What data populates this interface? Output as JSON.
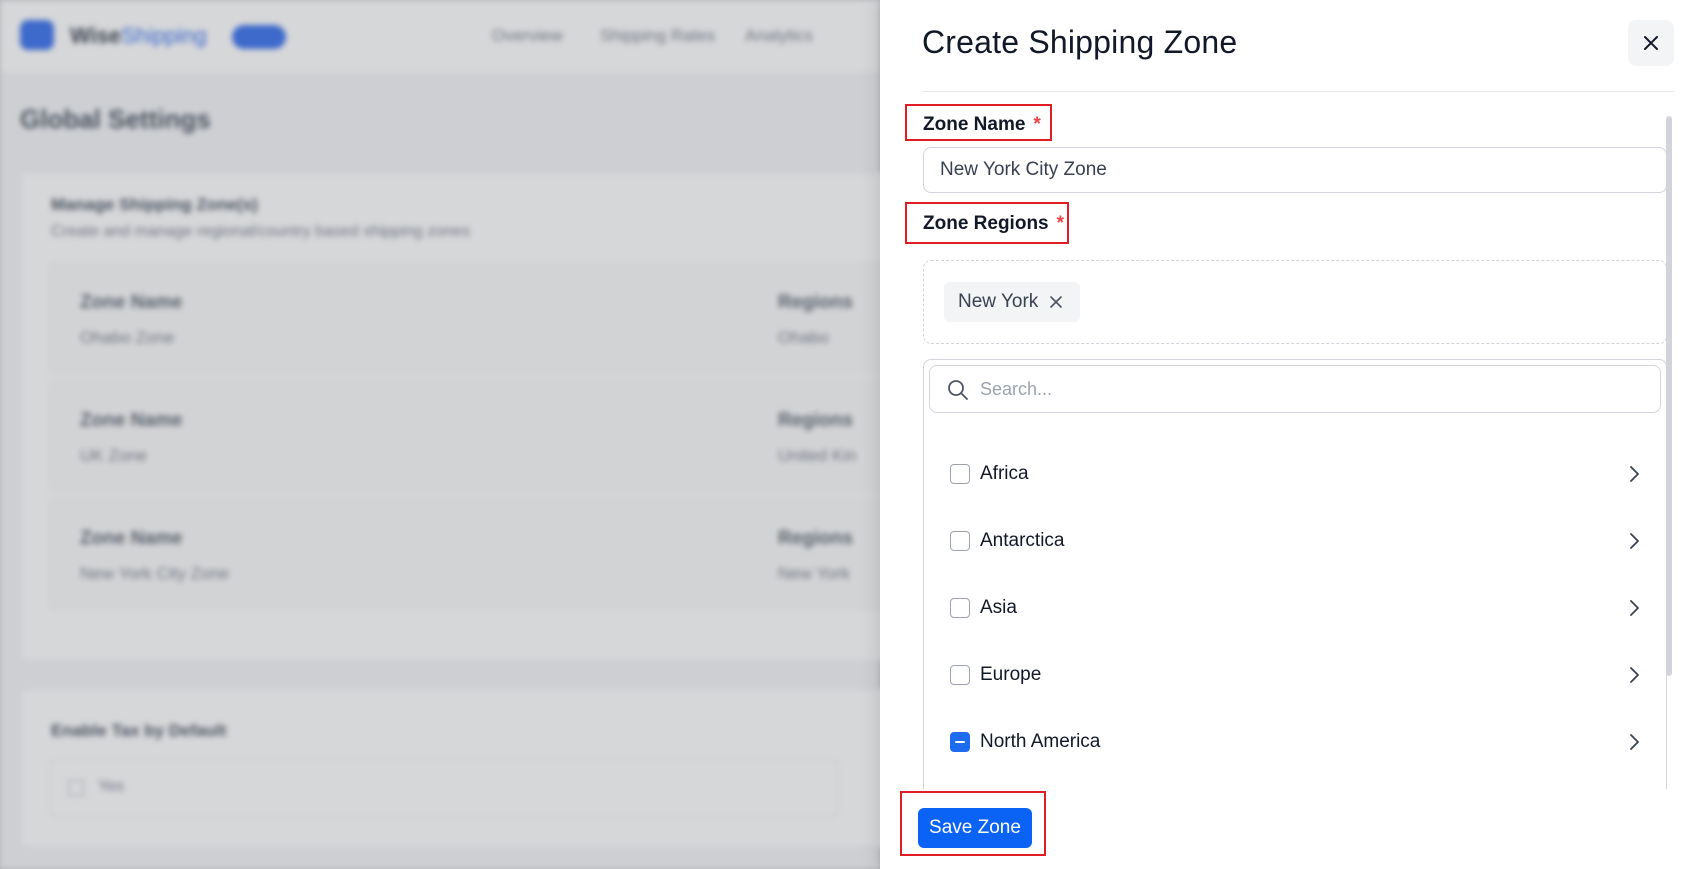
{
  "background": {
    "logo_text_dark": "Wise",
    "logo_text_accent": "Shipping",
    "nav": [
      "Overview",
      "Shipping Rates",
      "Analytics"
    ],
    "page_title": "Global Settings",
    "card_title": "Manage Shipping Zone(s)",
    "card_subtitle": "Create and manage regional/country based shipping zones",
    "zones": [
      {
        "label": "Zone Name",
        "value": "Ohabo Zone",
        "regions_label": "Regions",
        "regions_value": "Ohabo"
      },
      {
        "label": "Zone Name",
        "value": "UK Zone",
        "regions_label": "Regions",
        "regions_value": "United Kin"
      },
      {
        "label": "Zone Name",
        "value": "New York City Zone",
        "regions_label": "Regions",
        "regions_value": "New York"
      }
    ],
    "card2_title": "Enable Tax by Default",
    "card2_option": "Yes"
  },
  "drawer": {
    "title": "Create Shipping Zone",
    "zone_name": {
      "label": "Zone Name",
      "required_mark": "*",
      "value": "New York City Zone"
    },
    "zone_regions": {
      "label": "Zone Regions",
      "required_mark": "*",
      "selected": [
        {
          "label": "New York"
        }
      ]
    },
    "search": {
      "placeholder": "Search..."
    },
    "regions": [
      {
        "label": "Africa",
        "state": "unchecked"
      },
      {
        "label": "Antarctica",
        "state": "unchecked"
      },
      {
        "label": "Asia",
        "state": "unchecked"
      },
      {
        "label": "Europe",
        "state": "unchecked"
      },
      {
        "label": "North America",
        "state": "partial"
      }
    ],
    "save_label": "Save Zone"
  },
  "colors": {
    "primary": "#0b63f6",
    "highlight": "#e11d24",
    "required": "#ef4444"
  },
  "icons": {
    "close": "close-icon",
    "remove_chip": "x-icon",
    "search": "search-icon",
    "expand": "chevron-right-icon"
  }
}
